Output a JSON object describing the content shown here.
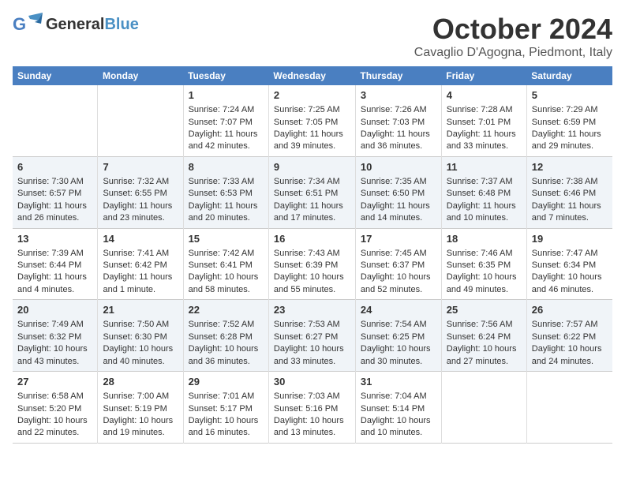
{
  "header": {
    "logo_general": "General",
    "logo_blue": "Blue",
    "title": "October 2024",
    "location": "Cavaglio D'Agogna, Piedmont, Italy"
  },
  "days_of_week": [
    "Sunday",
    "Monday",
    "Tuesday",
    "Wednesday",
    "Thursday",
    "Friday",
    "Saturday"
  ],
  "weeks": [
    [
      {
        "day": "",
        "sunrise": "",
        "sunset": "",
        "daylight": ""
      },
      {
        "day": "",
        "sunrise": "",
        "sunset": "",
        "daylight": ""
      },
      {
        "day": "1",
        "sunrise": "Sunrise: 7:24 AM",
        "sunset": "Sunset: 7:07 PM",
        "daylight": "Daylight: 11 hours and 42 minutes."
      },
      {
        "day": "2",
        "sunrise": "Sunrise: 7:25 AM",
        "sunset": "Sunset: 7:05 PM",
        "daylight": "Daylight: 11 hours and 39 minutes."
      },
      {
        "day": "3",
        "sunrise": "Sunrise: 7:26 AM",
        "sunset": "Sunset: 7:03 PM",
        "daylight": "Daylight: 11 hours and 36 minutes."
      },
      {
        "day": "4",
        "sunrise": "Sunrise: 7:28 AM",
        "sunset": "Sunset: 7:01 PM",
        "daylight": "Daylight: 11 hours and 33 minutes."
      },
      {
        "day": "5",
        "sunrise": "Sunrise: 7:29 AM",
        "sunset": "Sunset: 6:59 PM",
        "daylight": "Daylight: 11 hours and 29 minutes."
      }
    ],
    [
      {
        "day": "6",
        "sunrise": "Sunrise: 7:30 AM",
        "sunset": "Sunset: 6:57 PM",
        "daylight": "Daylight: 11 hours and 26 minutes."
      },
      {
        "day": "7",
        "sunrise": "Sunrise: 7:32 AM",
        "sunset": "Sunset: 6:55 PM",
        "daylight": "Daylight: 11 hours and 23 minutes."
      },
      {
        "day": "8",
        "sunrise": "Sunrise: 7:33 AM",
        "sunset": "Sunset: 6:53 PM",
        "daylight": "Daylight: 11 hours and 20 minutes."
      },
      {
        "day": "9",
        "sunrise": "Sunrise: 7:34 AM",
        "sunset": "Sunset: 6:51 PM",
        "daylight": "Daylight: 11 hours and 17 minutes."
      },
      {
        "day": "10",
        "sunrise": "Sunrise: 7:35 AM",
        "sunset": "Sunset: 6:50 PM",
        "daylight": "Daylight: 11 hours and 14 minutes."
      },
      {
        "day": "11",
        "sunrise": "Sunrise: 7:37 AM",
        "sunset": "Sunset: 6:48 PM",
        "daylight": "Daylight: 11 hours and 10 minutes."
      },
      {
        "day": "12",
        "sunrise": "Sunrise: 7:38 AM",
        "sunset": "Sunset: 6:46 PM",
        "daylight": "Daylight: 11 hours and 7 minutes."
      }
    ],
    [
      {
        "day": "13",
        "sunrise": "Sunrise: 7:39 AM",
        "sunset": "Sunset: 6:44 PM",
        "daylight": "Daylight: 11 hours and 4 minutes."
      },
      {
        "day": "14",
        "sunrise": "Sunrise: 7:41 AM",
        "sunset": "Sunset: 6:42 PM",
        "daylight": "Daylight: 11 hours and 1 minute."
      },
      {
        "day": "15",
        "sunrise": "Sunrise: 7:42 AM",
        "sunset": "Sunset: 6:41 PM",
        "daylight": "Daylight: 10 hours and 58 minutes."
      },
      {
        "day": "16",
        "sunrise": "Sunrise: 7:43 AM",
        "sunset": "Sunset: 6:39 PM",
        "daylight": "Daylight: 10 hours and 55 minutes."
      },
      {
        "day": "17",
        "sunrise": "Sunrise: 7:45 AM",
        "sunset": "Sunset: 6:37 PM",
        "daylight": "Daylight: 10 hours and 52 minutes."
      },
      {
        "day": "18",
        "sunrise": "Sunrise: 7:46 AM",
        "sunset": "Sunset: 6:35 PM",
        "daylight": "Daylight: 10 hours and 49 minutes."
      },
      {
        "day": "19",
        "sunrise": "Sunrise: 7:47 AM",
        "sunset": "Sunset: 6:34 PM",
        "daylight": "Daylight: 10 hours and 46 minutes."
      }
    ],
    [
      {
        "day": "20",
        "sunrise": "Sunrise: 7:49 AM",
        "sunset": "Sunset: 6:32 PM",
        "daylight": "Daylight: 10 hours and 43 minutes."
      },
      {
        "day": "21",
        "sunrise": "Sunrise: 7:50 AM",
        "sunset": "Sunset: 6:30 PM",
        "daylight": "Daylight: 10 hours and 40 minutes."
      },
      {
        "day": "22",
        "sunrise": "Sunrise: 7:52 AM",
        "sunset": "Sunset: 6:28 PM",
        "daylight": "Daylight: 10 hours and 36 minutes."
      },
      {
        "day": "23",
        "sunrise": "Sunrise: 7:53 AM",
        "sunset": "Sunset: 6:27 PM",
        "daylight": "Daylight: 10 hours and 33 minutes."
      },
      {
        "day": "24",
        "sunrise": "Sunrise: 7:54 AM",
        "sunset": "Sunset: 6:25 PM",
        "daylight": "Daylight: 10 hours and 30 minutes."
      },
      {
        "day": "25",
        "sunrise": "Sunrise: 7:56 AM",
        "sunset": "Sunset: 6:24 PM",
        "daylight": "Daylight: 10 hours and 27 minutes."
      },
      {
        "day": "26",
        "sunrise": "Sunrise: 7:57 AM",
        "sunset": "Sunset: 6:22 PM",
        "daylight": "Daylight: 10 hours and 24 minutes."
      }
    ],
    [
      {
        "day": "27",
        "sunrise": "Sunrise: 6:58 AM",
        "sunset": "Sunset: 5:20 PM",
        "daylight": "Daylight: 10 hours and 22 minutes."
      },
      {
        "day": "28",
        "sunrise": "Sunrise: 7:00 AM",
        "sunset": "Sunset: 5:19 PM",
        "daylight": "Daylight: 10 hours and 19 minutes."
      },
      {
        "day": "29",
        "sunrise": "Sunrise: 7:01 AM",
        "sunset": "Sunset: 5:17 PM",
        "daylight": "Daylight: 10 hours and 16 minutes."
      },
      {
        "day": "30",
        "sunrise": "Sunrise: 7:03 AM",
        "sunset": "Sunset: 5:16 PM",
        "daylight": "Daylight: 10 hours and 13 minutes."
      },
      {
        "day": "31",
        "sunrise": "Sunrise: 7:04 AM",
        "sunset": "Sunset: 5:14 PM",
        "daylight": "Daylight: 10 hours and 10 minutes."
      },
      {
        "day": "",
        "sunrise": "",
        "sunset": "",
        "daylight": ""
      },
      {
        "day": "",
        "sunrise": "",
        "sunset": "",
        "daylight": ""
      }
    ]
  ]
}
